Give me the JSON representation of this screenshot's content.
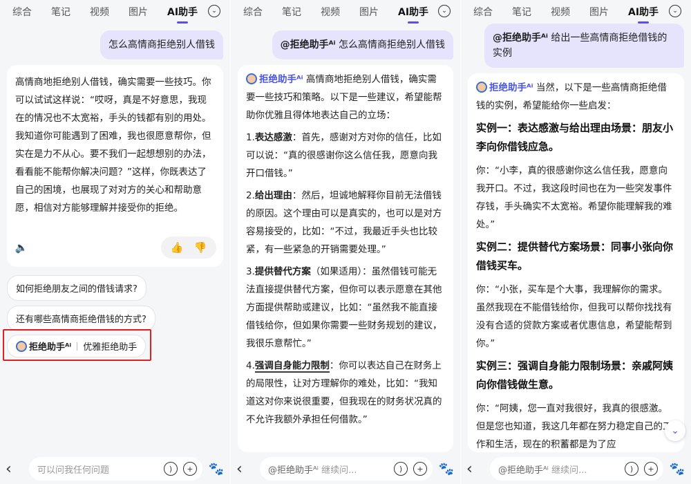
{
  "tabs": [
    "综合",
    "笔记",
    "视频",
    "图片",
    "AI助手"
  ],
  "panel1": {
    "user_query": "怎么高情商拒绝别人借钱",
    "answer": "高情商地拒绝别人借钱，确实需要一些技巧。你可以试试这样说：“哎呀，真是不好意思，我现在的情况也不太宽裕，手头的钱都有别的用处。我知道你可能遇到了困难，我也很愿意帮你，但实在是力不从心。要不我们一起想想别的办法，看看能不能帮你解决问题？”这样，你既表达了自己的困境，也展现了对对方的关心和帮助意愿，相信对方能够理解并接受你的拒绝。",
    "suggestions": [
      "如何拒绝朋友之间的借钱请求?",
      "还有哪些高情商拒绝借钱的方式?"
    ],
    "assistant_name": "拒绝助手ᴬⁱ",
    "assistant_desc": "优雅拒绝助手",
    "input_placeholder": "可以问我任何问题"
  },
  "panel2": {
    "mention": "@拒绝助手ᴬⁱ",
    "user_query": "怎么高情商拒绝别人借钱",
    "agent": "拒绝助手ᴬⁱ",
    "intro": "高情商地拒绝别人借钱，确实需要一些技巧和策略。以下是一些建议，希望能帮助你优雅且得体地表达自己的立场：",
    "points": [
      {
        "num": "1.",
        "title": "表达感激",
        "rest": "：首先，感谢对方对你的信任，比如可以说：“真的很感谢你这么信任我，愿意向我开口借钱。”"
      },
      {
        "num": "2.",
        "title": "给出理由",
        "rest": "：然后，坦诚地解释你目前无法借钱的原因。这个理由可以是真实的，也可以是对方容易接受的，比如：“不过，我最近手头也比较紧，有一些紧急的开销需要处理。”"
      },
      {
        "num": "3.",
        "title": "提供替代方案",
        "rest": "（如果适用）：虽然借钱可能无法直接提供替代方案，但你可以表示愿意在其他方面提供帮助或建议，比如：“虽然我不能直接借钱给你，但如果你需要一些财务规划的建议，我很乐意帮忙。”"
      },
      {
        "num": "4.",
        "title": "强调自身能力限制",
        "rest": "：你可以表达自己在财务上的局限性，让对方理解你的难处，比如：“我知道这对你来说很重要，但我现在的财务状况真的不允许我额外承担任何借款。”"
      }
    ],
    "input_mention": "@拒绝助手ᴬⁱ",
    "input_placeholder": "继续问..."
  },
  "panel3": {
    "mention": "@拒绝助手ᴬⁱ",
    "user_query": "给出一些高情商拒绝借钱的实例",
    "agent": "拒绝助手ᴬⁱ",
    "intro": "当然，以下是一些高情商拒绝借钱的实例，希望能给你一些启发：",
    "examples": [
      {
        "title": "实例一：表达感激与给出理由场景：朋友小李向你借钱应急。",
        "text": "你：“小李，真的很感谢你这么信任我，愿意向我开口。不过，我这段时间也在为一些突发事件存钱，手头确实不太宽裕。希望你能理解我的难处。”"
      },
      {
        "title": "实例二：提供替代方案场景：同事小张向你借钱买车。",
        "text": "你：“小张，买车是个大事，我理解你的需求。虽然我现在不能借钱给你，但我可以帮你找找有没有合适的贷款方案或者优惠信息，希望能帮到你。”"
      },
      {
        "title": "实例三：强调自身能力限制场景：亲戚阿姨向你借钱做生意。",
        "text": "你：“阿姨，您一直对我很好，我真的很感激。但是您也知道，我这几年都在努力稳定自己的工作和生活，现在的积蓄都是为了应"
      }
    ],
    "input_mention": "@拒绝助手ᴬⁱ",
    "input_placeholder": "继续问..."
  }
}
